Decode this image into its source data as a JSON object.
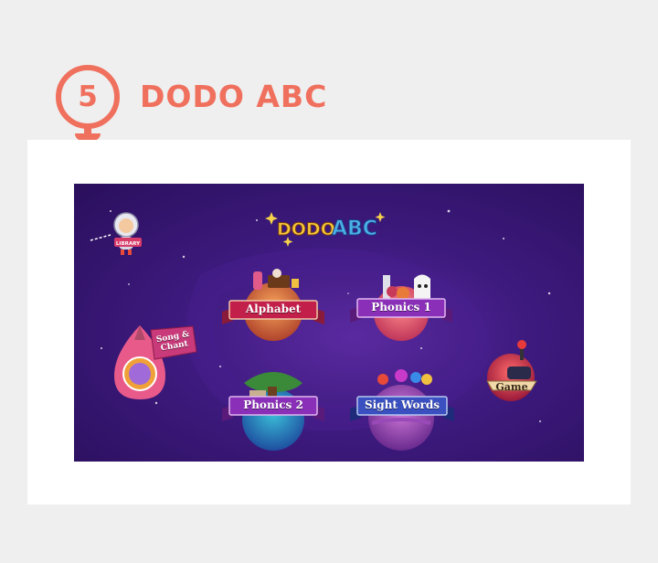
{
  "step": {
    "number": "5",
    "title": "DODO ABC"
  },
  "app": {
    "logo": {
      "part1": "DODO",
      "part2": "ABC"
    },
    "library_label": "LIBRARY",
    "menu": {
      "alphabet": "Alphabet",
      "phonics1": "Phonics 1",
      "phonics2": "Phonics 2",
      "sight_words": "Sight Words",
      "song_line1": "Song &",
      "song_line2": "Chant",
      "game": "Game"
    }
  },
  "colors": {
    "accent": "#f0705e",
    "screen_bg": "#3d1a7e",
    "ribbon_red": "#c21f4a",
    "ribbon_purple": "#8a2fb8",
    "ribbon_blue": "#3a4fc0"
  }
}
